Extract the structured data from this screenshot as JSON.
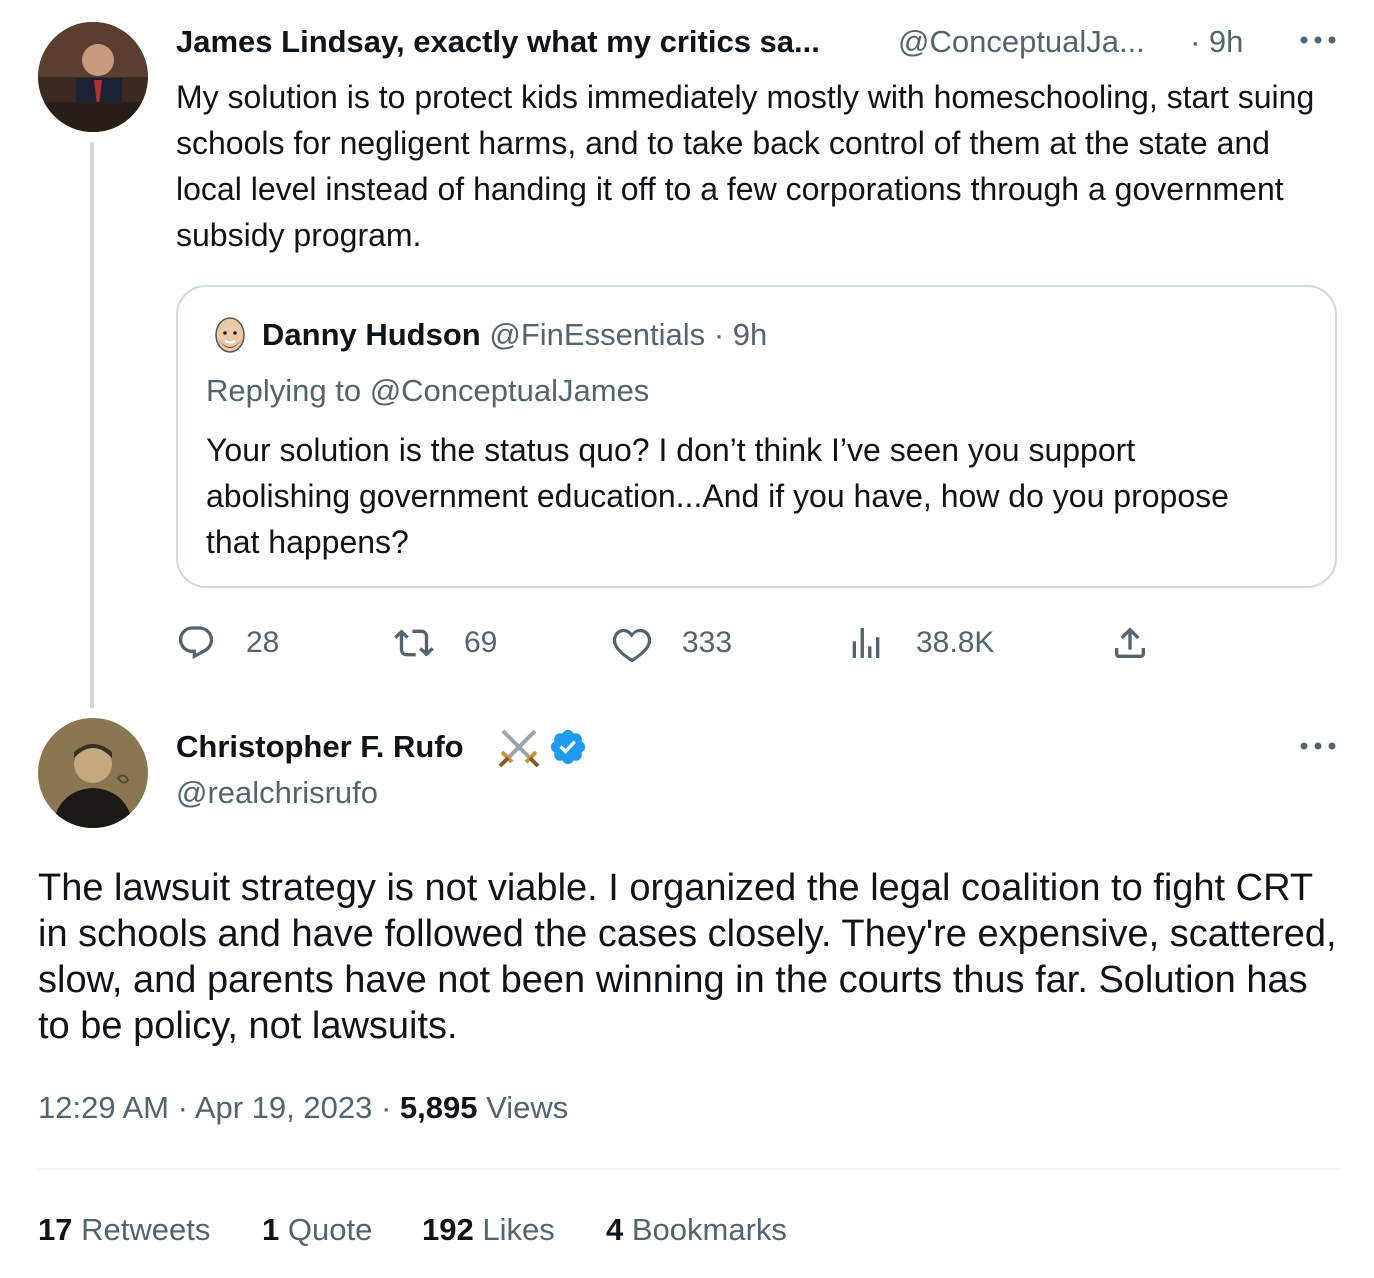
{
  "parent_tweet": {
    "display_name": "James Lindsay, exactly what my critics sa...",
    "handle": "@ConceptualJa...",
    "time": "· 9h",
    "more_icon": "more-dots-icon",
    "text": "My solution is to protect kids immediately mostly with homeschooling, start suing schools for negligent harms, and to take back control of them at the state and local level instead of handing it off to a few corporations through a government subsidy program.",
    "quoted": {
      "display_name": "Danny Hudson",
      "handle": "@FinEssentials",
      "time": "· 9h",
      "replying_to": "Replying to @ConceptualJames",
      "text": "Your solution is the status quo? I don’t think I’ve seen you support abolishing government education...And if you have, how do you propose that happens?"
    },
    "actions": {
      "replies": "28",
      "retweets": "69",
      "likes": "333",
      "views": "38.8K"
    }
  },
  "main_tweet": {
    "display_name": "Christopher F. Rufo",
    "name_emoji": "⚔️",
    "handle": "@realchrisrufo",
    "text": "The lawsuit strategy is not viable. I organized the legal coalition to fight CRT in schools and have followed the cases closely. They're expensive, scattered, slow, and parents have not been winning in the courts thus far. Solution has to be policy, not lawsuits.",
    "timestamp": "12:29 AM · Apr 19, 2023 ·",
    "views_count": "5,895",
    "views_label": "Views",
    "stats": {
      "retweets_count": "17",
      "retweets_label": "Retweets",
      "quotes_count": "1",
      "quotes_label": "Quote",
      "likes_count": "192",
      "likes_label": "Likes",
      "bookmarks_count": "4",
      "bookmarks_label": "Bookmarks"
    }
  },
  "colors": {
    "text": "#0f1419",
    "muted": "#536471",
    "border": "#cfd9de",
    "verified": "#1d9bf0"
  }
}
